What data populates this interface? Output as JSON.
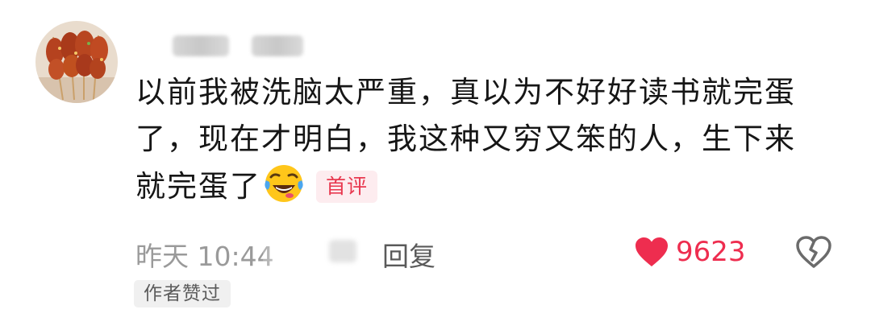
{
  "comment": {
    "text_line1": "以前我被洗脑太严重，真以为不好好读书就完蛋",
    "text_line2": "了，现在才明白，我这种又穷又笨的人，生下来",
    "text_line3": "就完蛋了",
    "emoji_icon": "laughing-crying-face-icon",
    "first_badge": "首评",
    "time": "昨天 10:44",
    "reply_label": "回复",
    "like_count": "9623",
    "author_liked": "作者赞过"
  },
  "avatar_icon": "food-skewers-avatar",
  "colors": {
    "like_red": "#ee2d4f",
    "badge_red": "#e8384f",
    "badge_bg": "#fdecef",
    "meta_gray": "#9a9a9a"
  }
}
